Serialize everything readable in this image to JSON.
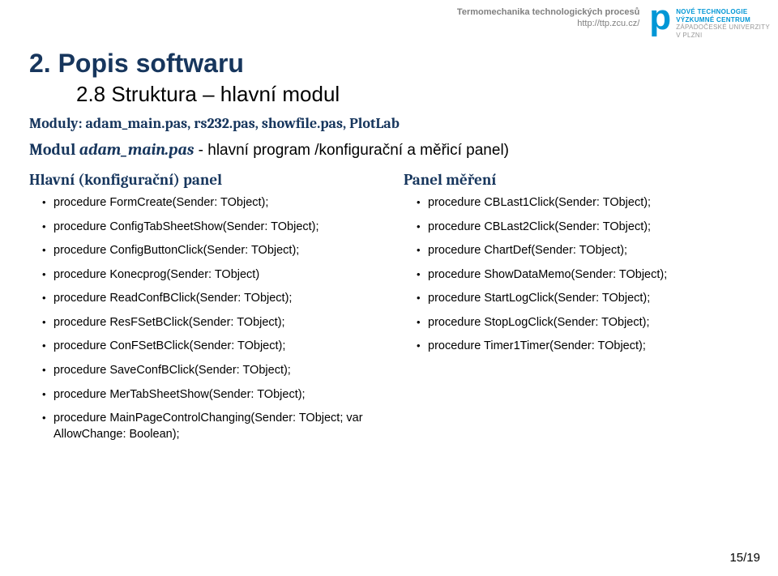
{
  "header": {
    "line1": "Termomechanika technologických procesů",
    "line2": "http://ttp.zcu.cz/",
    "logo_letter": "p",
    "logo_lines": [
      "NOVÉ TECHNOLOGIE",
      "VÝZKUMNÉ CENTRUM",
      "ZÁPADOČESKÉ UNIVERZITY",
      "V PLZNI"
    ]
  },
  "title": "2. Popis softwaru",
  "subtitle": "2.8 Struktura – hlavní modul",
  "moduly_line": "Moduly: adam_main.pas, rs232.pas, showfile.pas, PlotLab",
  "modul_prefix": "Modul ",
  "modul_name": "adam_main.pas",
  "modul_tail": " - hlavní program /konfigurační a měřicí panel)",
  "left": {
    "title": "Hlavní (konfigurační) panel",
    "items": [
      "procedure FormCreate(Sender: TObject);",
      "procedure ConfigTabSheetShow(Sender: TObject);",
      "procedure ConfigButtonClick(Sender: TObject);",
      "procedure Konecprog(Sender: TObject)",
      "procedure ReadConfBClick(Sender: TObject);",
      "procedure ResFSetBClick(Sender: TObject);",
      "procedure ConFSetBClick(Sender: TObject);",
      "procedure SaveConfBClick(Sender: TObject);",
      "procedure MerTabSheetShow(Sender: TObject);",
      "procedure MainPageControlChanging(Sender: TObject; var AllowChange: Boolean);"
    ]
  },
  "right": {
    "title": "Panel měření",
    "items": [
      "procedure CBLast1Click(Sender: TObject);",
      "procedure CBLast2Click(Sender: TObject);",
      "procedure ChartDef(Sender: TObject);",
      "procedure ShowDataMemo(Sender: TObject);",
      "procedure StartLogClick(Sender: TObject);",
      "procedure StopLogClick(Sender: TObject);",
      "procedure Timer1Timer(Sender: TObject);"
    ]
  },
  "page": "15/19"
}
